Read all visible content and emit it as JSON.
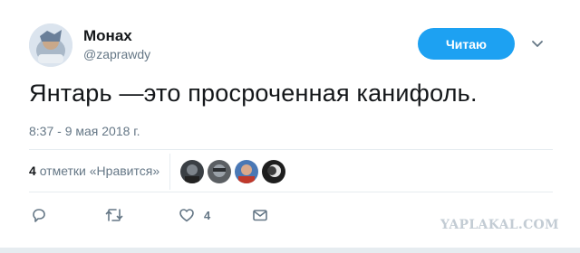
{
  "header": {
    "display_name": "Монах",
    "handle": "@zaprawdy",
    "follow_label": "Читаю"
  },
  "tweet": {
    "text": "Янтарь —это просроченная канифоль.",
    "timestamp": "8:37 - 9 мая 2018 г."
  },
  "likes": {
    "count": "4",
    "label": "отметки «Нравится»"
  },
  "actions": {
    "reply_icon": "reply-icon",
    "retweet_icon": "retweet-icon",
    "like_icon": "heart-icon",
    "like_count": "4",
    "dm_icon": "envelope-icon"
  },
  "watermark": "YAPLAKAL.COM",
  "colors": {
    "accent": "#1da1f2",
    "secondary_text": "#657786",
    "primary_text": "#14171a",
    "divider": "#e6ecf0"
  }
}
